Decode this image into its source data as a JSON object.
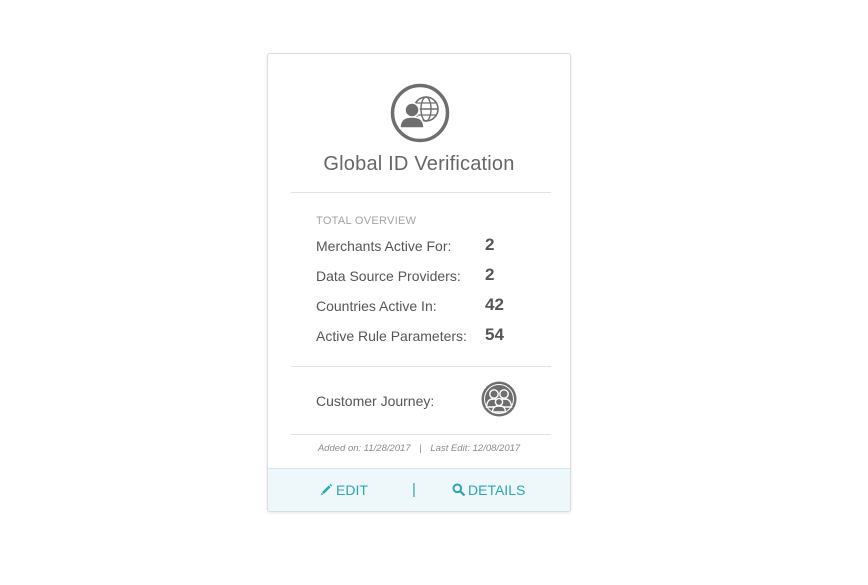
{
  "card": {
    "title": "Global ID Verification",
    "icon": "user-globe-icon",
    "overview": {
      "heading": "TOTAL OVERVIEW",
      "stats": [
        {
          "label": "Merchants Active For:",
          "value": "2"
        },
        {
          "label": "Data Source Providers:",
          "value": "2"
        },
        {
          "label": "Countries Active In:",
          "value": "42"
        },
        {
          "label": "Active Rule Parameters:",
          "value": "54"
        }
      ]
    },
    "journey": {
      "label": "Customer Journey:",
      "icon": "customer-group-icon"
    },
    "meta": {
      "added": "Added on: 11/28/2017",
      "separator": "|",
      "last_edit": "Last Edit: 12/08/2017"
    },
    "actions": {
      "edit_label": "EDIT",
      "edit_icon": "pencil-icon",
      "separator": "|",
      "details_label": "DETAILS",
      "details_icon": "search-icon"
    }
  },
  "colors": {
    "accent": "#2fa3b6",
    "footer_bg": "#eef8fa",
    "icon_gray": "#6e6e6e",
    "text": "#555555"
  }
}
